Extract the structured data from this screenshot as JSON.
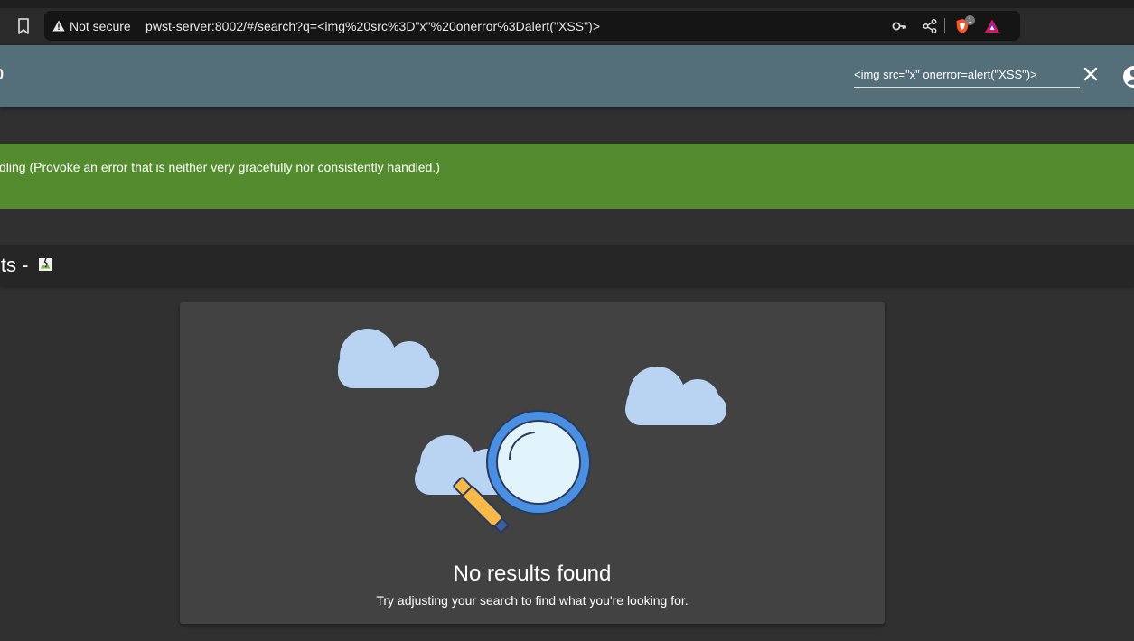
{
  "browser": {
    "security_label": "Not secure",
    "url": "pwst-server:8002/#/search?q=<img%20src%3D\"x\"%20onerror%3Dalert(\"XSS\")>",
    "shield_count": "1",
    "icons": [
      "bookmark-icon",
      "warning-icon",
      "key-icon",
      "share-icon",
      "brave-shield-icon",
      "brave-rewards-icon"
    ]
  },
  "toolbar": {
    "app_title": "p",
    "search_value": "<img src=\"x\" onerror=alert(\"XSS\")>",
    "icons": [
      "close-icon",
      "account-icon"
    ]
  },
  "challenge": {
    "text": "dling (Provoke an error that is neither very gracefully nor consistently handled.)"
  },
  "results": {
    "title_prefix": "lts - "
  },
  "empty_state": {
    "title": "No results found",
    "hint": "Try adjusting your search to find what you're looking for.",
    "illustration": "clouds-and-magnifier"
  },
  "colors": {
    "toolbar": "#546e7a",
    "challenge_banner": "#558b2f",
    "card": "#424242",
    "background": "#303030"
  }
}
